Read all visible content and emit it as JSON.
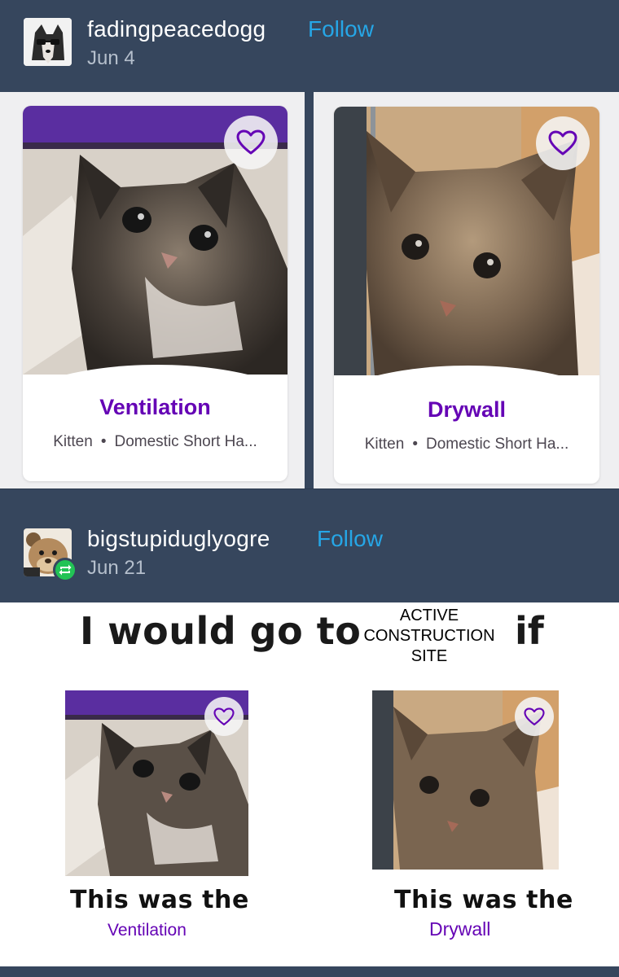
{
  "posts": [
    {
      "username": "fadingpeacedogg",
      "follow_label": "Follow",
      "date": "Jun 4",
      "avatar_icon": "husky-sunglasses-avatar",
      "cards": [
        {
          "name": "Ventilation",
          "type": "Kitten",
          "breed": "Domestic Short Ha...",
          "heart_icon": "heart-outline-icon"
        },
        {
          "name": "Drywall",
          "type": "Kitten",
          "breed": "Domestic Short Ha...",
          "heart_icon": "heart-outline-icon"
        }
      ]
    },
    {
      "username": "bigstupiduglyogre",
      "follow_label": "Follow",
      "date": "Jun 21",
      "avatar_icon": "ogre-avatar",
      "reblog_icon": "reblog-icon",
      "meme": {
        "line1": "I would go to",
        "stack": [
          "ACTIVE",
          "CONSTRUCTION",
          "SITE"
        ],
        "if_word": "if",
        "caption_left": "This was the",
        "caption_right": "This was the",
        "name_left": "Ventilation",
        "name_right": "Drywall"
      }
    }
  ],
  "separator": "•",
  "colors": {
    "background": "#36465d",
    "follow": "#26a6e6",
    "purple": "#6504b5",
    "reblog_green": "#22c355",
    "panel": "#efeff1"
  }
}
